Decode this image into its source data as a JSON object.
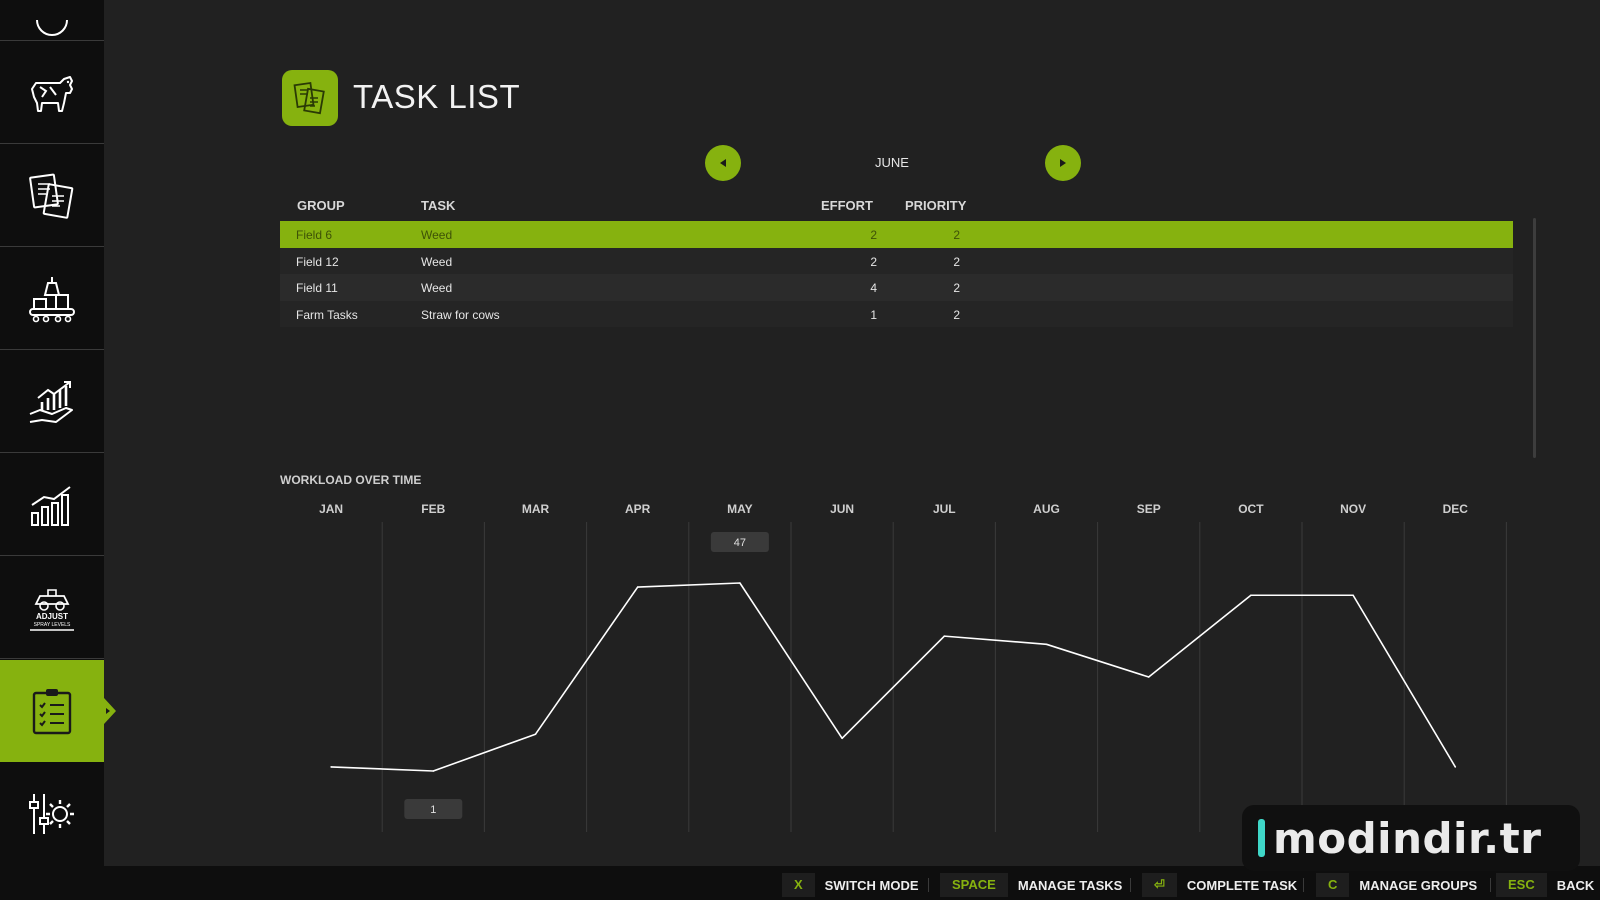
{
  "app": {
    "title": "TASK LIST"
  },
  "sidebar": {
    "items": [
      {
        "icon": "cow-icon",
        "active": false
      },
      {
        "icon": "documents-icon",
        "active": false
      },
      {
        "icon": "production-icon",
        "active": false
      },
      {
        "icon": "finance-growth-icon",
        "active": false
      },
      {
        "icon": "statistics-icon",
        "active": false
      },
      {
        "icon": "adjust-spray-levels-icon",
        "active": false,
        "logo_text": "ADJUST SPRAY LEVELS"
      },
      {
        "icon": "task-clipboard-icon",
        "active": true
      },
      {
        "icon": "settings-sliders-icon",
        "active": false
      }
    ]
  },
  "month_nav": {
    "current": "JUNE"
  },
  "table": {
    "headers": {
      "group": "GROUP",
      "task": "TASK",
      "effort": "EFFORT",
      "priority": "PRIORITY"
    },
    "rows": [
      {
        "group": "Field 6",
        "task": "Weed",
        "effort": "2",
        "priority": "2",
        "selected": true
      },
      {
        "group": "Field 12",
        "task": "Weed",
        "effort": "2",
        "priority": "2",
        "selected": false
      },
      {
        "group": "Field 11",
        "task": "Weed",
        "effort": "4",
        "priority": "2",
        "selected": false
      },
      {
        "group": "Farm Tasks",
        "task": "Straw for cows",
        "effort": "1",
        "priority": "2",
        "selected": false
      }
    ]
  },
  "chart_title": "WORKLOAD OVER TIME",
  "chart_data": {
    "type": "line",
    "categories": [
      "JAN",
      "FEB",
      "MAR",
      "APR",
      "MAY",
      "JUN",
      "JUL",
      "AUG",
      "SEP",
      "OCT",
      "NOV",
      "DEC"
    ],
    "series": [
      {
        "values": [
          2,
          1,
          10,
          46,
          47,
          9,
          34,
          32,
          24,
          44,
          44,
          2
        ]
      }
    ],
    "max_label": "47",
    "min_label": "1",
    "ylim": [
      1,
      47
    ],
    "grid": true,
    "line_color": "#ffffff"
  },
  "bottom_bar": {
    "hints": [
      {
        "key": "X",
        "label": "SWITCH MODE"
      },
      {
        "key": "SPACE",
        "label": "MANAGE TASKS"
      },
      {
        "key": "⏎",
        "label": "COMPLETE TASK"
      },
      {
        "key": "C",
        "label": "MANAGE GROUPS"
      },
      {
        "key": "ESC",
        "label": "BACK"
      }
    ]
  },
  "watermark": {
    "text": "modindir.tr"
  },
  "colors": {
    "accent": "#86b20f",
    "background": "#212121",
    "sidebar": "#0e0e0e"
  }
}
